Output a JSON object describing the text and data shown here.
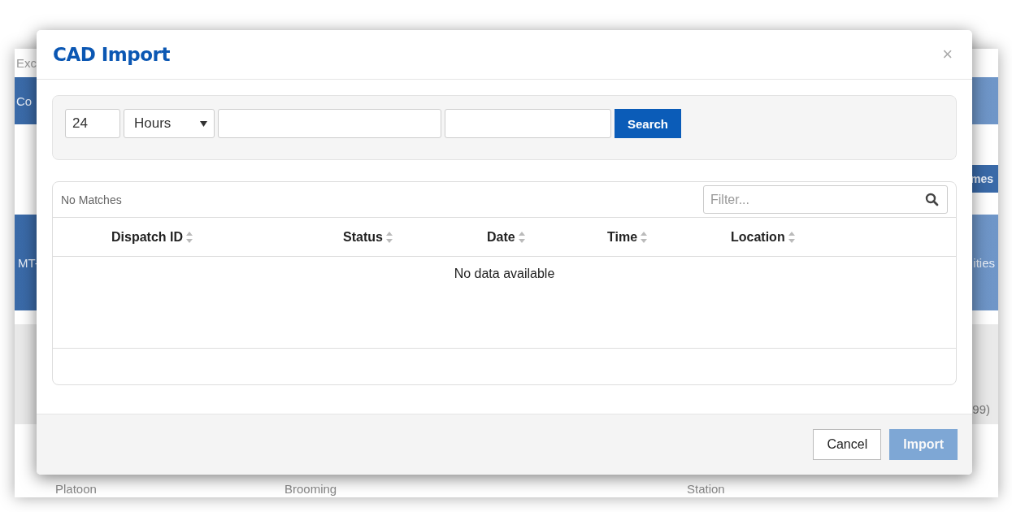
{
  "background": {
    "top_text": "Exc",
    "bar_left": "Co",
    "button_right": "mes",
    "band_left": "MT-",
    "band_right": "ities",
    "row_right": "99)",
    "bottom_fields": [
      "Platoon",
      "Brooming",
      "Station"
    ]
  },
  "dialog": {
    "title": "CAD Import",
    "close": "×",
    "search_panel": {
      "amount": "24",
      "unit": "Hours",
      "search_button": "Search"
    },
    "results": {
      "info": "No Matches",
      "filter": {
        "placeholder": "Filter..."
      },
      "columns": [
        {
          "label": "Dispatch ID"
        },
        {
          "label": "Status"
        },
        {
          "label": "Date"
        },
        {
          "label": "Time"
        },
        {
          "label": "Location"
        }
      ],
      "empty_message": "No data available"
    },
    "buttons": [
      {
        "label": "Cancel",
        "kind": "secondary",
        "disabled": false
      },
      {
        "label": "Import",
        "kind": "primary",
        "disabled": true
      }
    ]
  }
}
